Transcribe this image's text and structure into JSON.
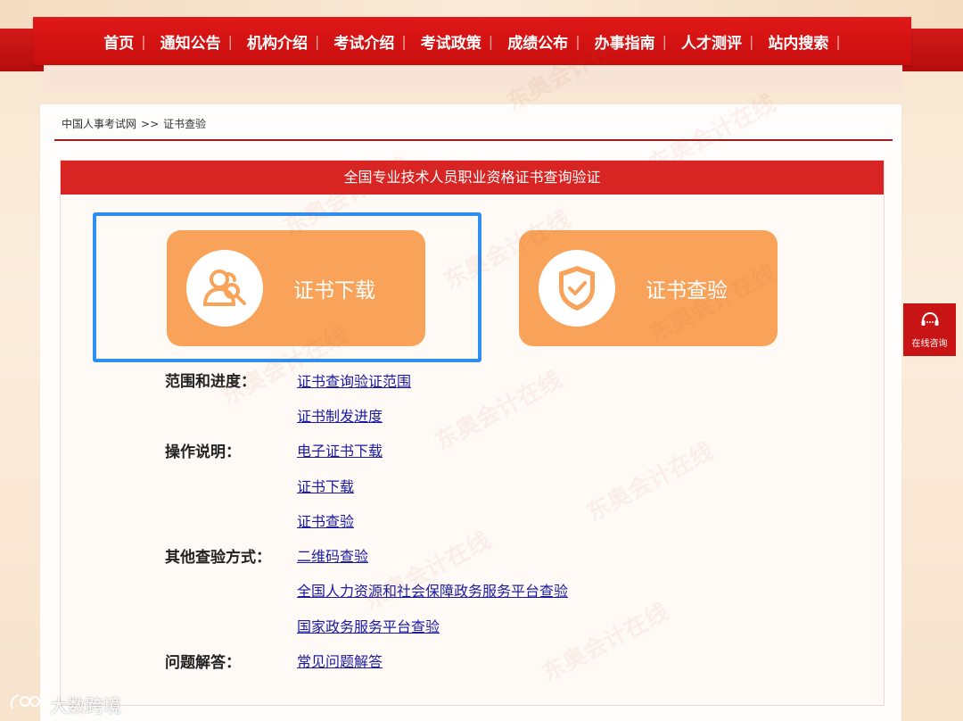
{
  "nav": {
    "items": [
      "首页",
      "通知公告",
      "机构介绍",
      "考试介绍",
      "考试政策",
      "成绩公布",
      "办事指南",
      "人才测评",
      "站内搜索"
    ]
  },
  "breadcrumb": {
    "home": "中国人事考试网",
    "separator": ">>",
    "current": "证书查验"
  },
  "section": {
    "title": "全国专业技术人员职业资格证书查询验证"
  },
  "buttons": {
    "download": {
      "label": "证书下载",
      "icon": "user-search-icon"
    },
    "verify": {
      "label": "证书查验",
      "icon": "shield-check-icon"
    }
  },
  "groups": [
    {
      "label": "范围和进度：",
      "links": [
        "证书查询验证范围",
        "证书制发进度"
      ]
    },
    {
      "label": "操作说明：",
      "links": [
        "电子证书下载",
        "证书下载",
        "证书查验"
      ]
    },
    {
      "label": "其他查验方式：",
      "links": [
        "二维码查验",
        "全国人力资源和社会保障政务服务平台查验",
        "国家政务服务平台查验"
      ]
    },
    {
      "label": "问题解答：",
      "links": [
        "常见问题解答"
      ]
    }
  ],
  "float_consult": {
    "label": "在线咨询"
  },
  "watermark": {
    "text": "东奥会计在线"
  },
  "footer_logo": {
    "text": "大数跨境"
  },
  "colors": {
    "nav_red": "#d41a1a",
    "button_orange": "#f9a35a",
    "highlight_blue": "#2f8ff0",
    "link_blue": "#1a1aa0"
  }
}
